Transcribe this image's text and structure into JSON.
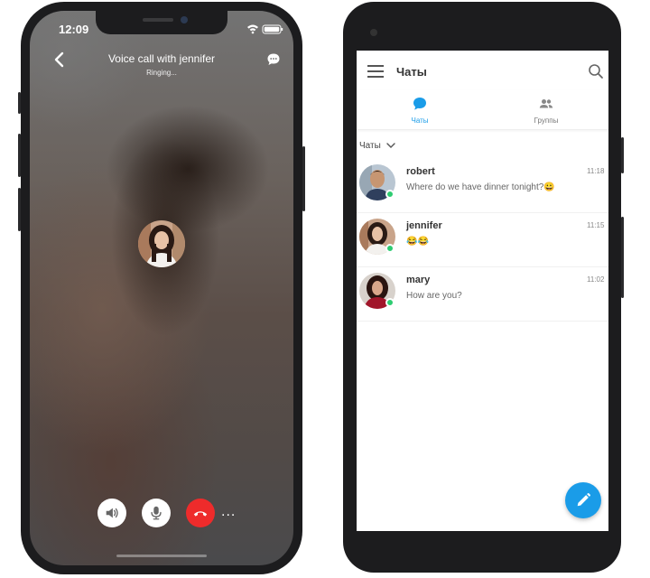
{
  "ios_call": {
    "status_time": "12:09",
    "title": "Voice call with jennifer",
    "subtitle": "Ringing...",
    "more_label": "...",
    "icons": [
      "back-chevron-icon",
      "chat-bubble-icon",
      "speaker-icon",
      "microphone-icon",
      "end-call-icon"
    ],
    "colors": {
      "end_call": "#ee2b2b"
    }
  },
  "android_app": {
    "title": "Чаты",
    "tabs": [
      {
        "label": "Чаты",
        "active": true,
        "icon": "chat-bubble-icon"
      },
      {
        "label": "Группы",
        "active": false,
        "icon": "group-icon"
      }
    ],
    "filter_label": "Чаты",
    "chats": [
      {
        "name": "robert",
        "time": "11:18",
        "message": "Where do we have dinner tonight?😀",
        "online": true
      },
      {
        "name": "jennifer",
        "time": "11:15",
        "message": "😂😂",
        "online": true
      },
      {
        "name": "mary",
        "time": "11:02",
        "message": "How are you?",
        "online": true
      }
    ],
    "colors": {
      "accent": "#1a9ce8",
      "online": "#2ecc71"
    }
  }
}
